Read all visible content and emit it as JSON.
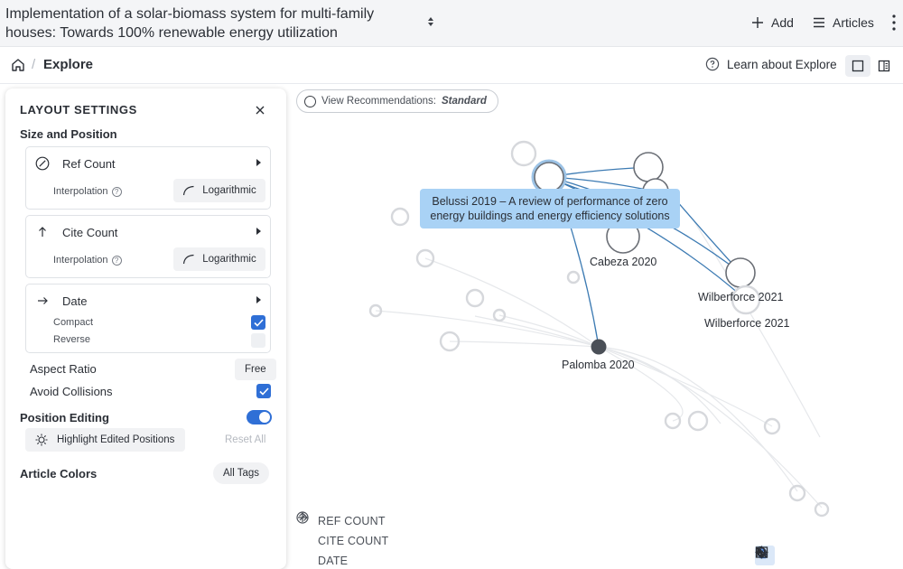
{
  "header": {
    "document_title": "Implementation of a solar-biomass system for multi-family houses: Towards 100% renewable energy utilization",
    "add_label": "Add",
    "articles_label": "Articles"
  },
  "subbar": {
    "breadcrumb_separator": "/",
    "page_name": "Explore",
    "learn_label": "Learn about Explore"
  },
  "layout_settings": {
    "title": "LAYOUT SETTINGS",
    "size_position_heading": "Size and Position",
    "ref_count": {
      "label": "Ref Count",
      "interpolation_label": "Interpolation",
      "interpolation_value": "Logarithmic"
    },
    "cite_count": {
      "label": "Cite Count",
      "interpolation_label": "Interpolation",
      "interpolation_value": "Logarithmic"
    },
    "date": {
      "label": "Date",
      "compact_label": "Compact",
      "compact_checked": true,
      "reverse_label": "Reverse",
      "reverse_checked": false
    },
    "aspect_ratio_label": "Aspect Ratio",
    "aspect_ratio_value": "Free",
    "avoid_collisions_label": "Avoid Collisions",
    "avoid_collisions_checked": true,
    "position_editing_label": "Position Editing",
    "position_editing_on": true,
    "highlight_label": "Highlight Edited Positions",
    "reset_label": "Reset All",
    "article_colors_label": "Article Colors",
    "article_colors_value": "All Tags"
  },
  "graph": {
    "recommendations_label": "View Recommendations:",
    "recommendations_value": "Standard",
    "tooltip": "Belussi 2019 – A review of performance of zero energy buildings and energy efficiency solutions",
    "node_labels": {
      "cabeza": "Cabeza 2020",
      "wilberforce_a": "Wilberforce 2021",
      "wilberforce_b": "Wilberforce 2021",
      "palomba": "Palomba 2020"
    },
    "legend": {
      "ref": "REF COUNT",
      "cite": "CITE COUNT",
      "date": "DATE"
    }
  },
  "colors": {
    "accent": "#2f6fd6",
    "edge": "#3d7bb3",
    "tooltip_bg": "#a9d2f5",
    "node_stroke": "#6b6f76"
  }
}
